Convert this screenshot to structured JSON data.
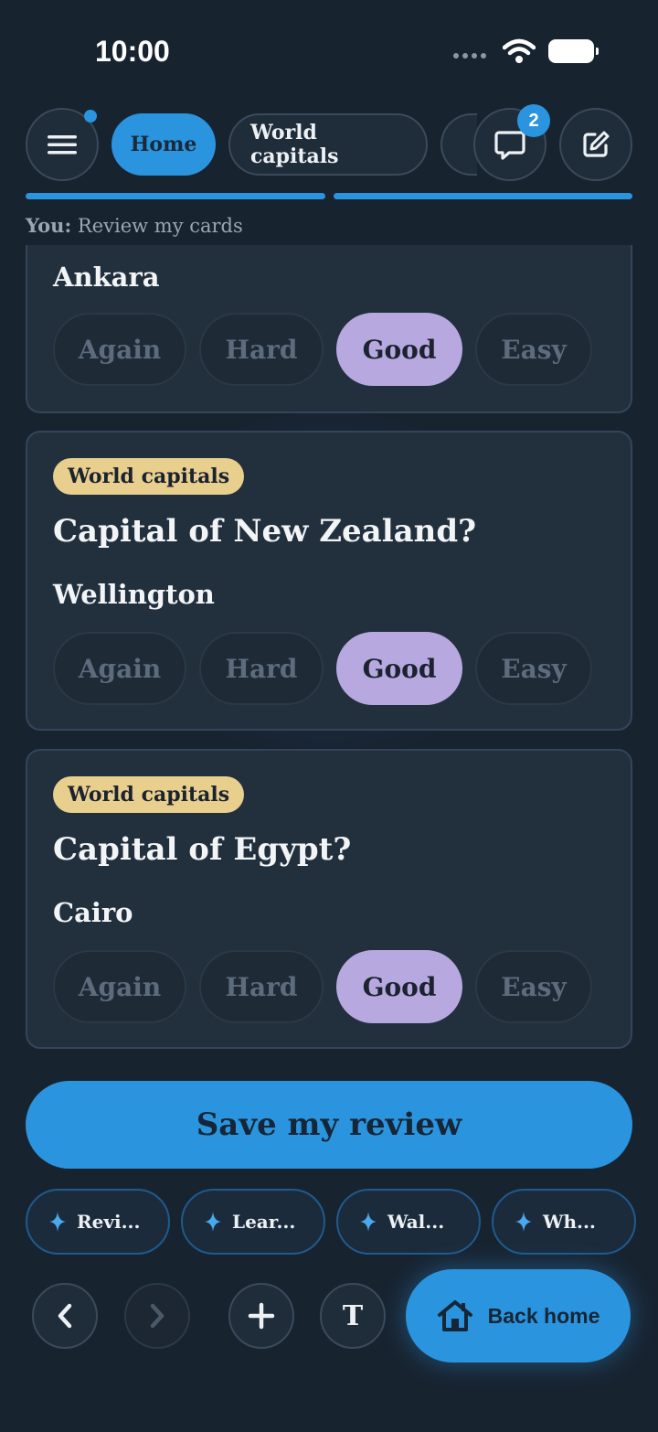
{
  "status": {
    "time": "10:00"
  },
  "nav": {
    "tabs": [
      {
        "label": "Home",
        "active": true
      },
      {
        "label": "World capitals",
        "active": false
      }
    ],
    "chat_badge": "2"
  },
  "context": {
    "prefix": "You:",
    "text": "Review my cards"
  },
  "rating_labels": {
    "again": "Again",
    "hard": "Hard",
    "good": "Good",
    "easy": "Easy"
  },
  "cards": [
    {
      "tag": "",
      "question": "",
      "answer": "Ankara",
      "selected": "Good"
    },
    {
      "tag": "World capitals",
      "question": "Capital of New Zealand?",
      "answer": "Wellington",
      "selected": "Good"
    },
    {
      "tag": "World capitals",
      "question": "Capital of Egypt?",
      "answer": "Cairo",
      "selected": "Good"
    }
  ],
  "save_label": "Save my review",
  "suggestions": [
    "Revi...",
    "Lear...",
    "Wal...",
    "Wh..."
  ],
  "toolbar": {
    "text_button": "T",
    "back_home": "Back home"
  },
  "colors": {
    "accent": "#2a94de",
    "selected_rating": "#b7a9e0",
    "tag": "#e8cf8d",
    "background": "#182330"
  }
}
